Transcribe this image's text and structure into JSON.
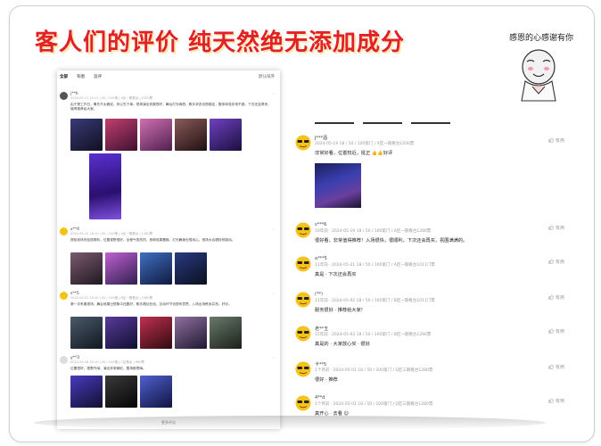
{
  "banner": {
    "title": "客人们的评价 纯天然绝无添加成分",
    "thanks": "感恩的心感谢有你"
  },
  "left_panel": {
    "tabs": [
      "全部",
      "有图",
      "追评"
    ],
    "sort_label": "默认排序",
    "more_label": "更多评论",
    "reviews": [
      {
        "name": "j**h",
        "meta": "2024-05-11 12:11 | 50 / 100第 | X区一期看台 | 1200票",
        "text": "由于是工作日，事先不太确定，所以先下单。现场演出效果很好，舞台灯光绚丽，歌手状态也很稳定，整体体验非常不错，下次还会再来，值得推荐给大家。",
        "thumb_colors": [
          "#2a2a5a",
          "#a03060",
          "#b05090",
          "#6a3a3a",
          "#5a2a90"
        ]
      },
      {
        "name": "x**4",
        "meta": "2024-05-10 18:10 | 50 / 100第 | A区一期看台 | 1280票",
        "text": "提前到场安检很顺利，位置视野很好。全程气氛热烈，音响效果震撼，灯光舞美也很用心，现场大合唱特别感动。",
        "thumb_colors": [
          "#5a3a50",
          "#b050c0",
          "#3050a0",
          "#1a2a60"
        ]
      },
      {
        "name": "s**5",
        "meta": "2024-05-02 19:10 | 50 / 100第 | B区一期看台 | 1080票",
        "text": "第一次来看现场，舞台效果比想象中还要好，歌手唱功在线，互动环节也很有意思，入场出场秩序井然，好评。",
        "thumb_colors": [
          "#2a3a4a",
          "#3a2a6a",
          "#a02040",
          "#6a5080",
          "#4a5a4a"
        ]
      },
      {
        "name": "y**3",
        "meta": "2024-04-28 20:10 | 50 / 100第 | C区看台 | 980票",
        "text": "位置很好，视野开阔，演出非常精彩，整场都很嗨。",
        "thumb_colors": [
          "#3a2a9a",
          "#1a1a1a",
          "#4050b0"
        ]
      }
    ]
  },
  "right_list": {
    "reviews": [
      {
        "name": "J***酒",
        "meta": "2024-05-19 18 / 50 / 100第门 / X区一期看台1200票",
        "text": "非常好看，位置较近，挺正 👍👍好评",
        "likes": "有用",
        "has_photo": true
      },
      {
        "name": "s***6",
        "meta": "19年前 · 2024-05-19 18 / 50 / 100第门 / A区一期看台1280票",
        "text": "很好看，非常值得推荐！入场很快，很顺利，下次还会再买，氛围满满的。",
        "likes": "有用",
        "has_photo": false
      },
      {
        "name": "a***5",
        "meta": "11年前 · 2024-05-21 18 / 50 / 100第门 / A区一期看台1011门票",
        "text": "真是 · 下次还会再买",
        "likes": "有用",
        "has_photo": false
      },
      {
        "name": "(**)",
        "meta": "11年前 · 2024-05-02 18 / 50 / 100第门 / B区一期看台1011门票",
        "text": "服务很好 · 推荐给大家！",
        "likes": "有用",
        "has_photo": false
      },
      {
        "name": "老**玉",
        "meta": "15年前 · 2024-05-03 18 / 50 / 100第门 / B区一期看台1280票",
        "text": "真是的 · 大家放心买 · 很好",
        "likes": "有用",
        "has_photo": false
      },
      {
        "name": "卡**5",
        "meta": "1个月前 · 2024-05-01 18 / 50 / 100第门 / D区三期看台1280票",
        "text": "很好 · 推荐",
        "likes": "有用",
        "has_photo": false
      },
      {
        "name": "4**d",
        "meta": "1个月前 · 2024-05-01 18 / 50 / 100第门 / D区三期看台1280票",
        "text": "真开心 · 去看 😊",
        "likes": "有用",
        "has_photo": false
      }
    ]
  },
  "colors": {
    "title_red": "#e0202a",
    "text_dark": "#222222",
    "meta_gray": "#999999"
  }
}
